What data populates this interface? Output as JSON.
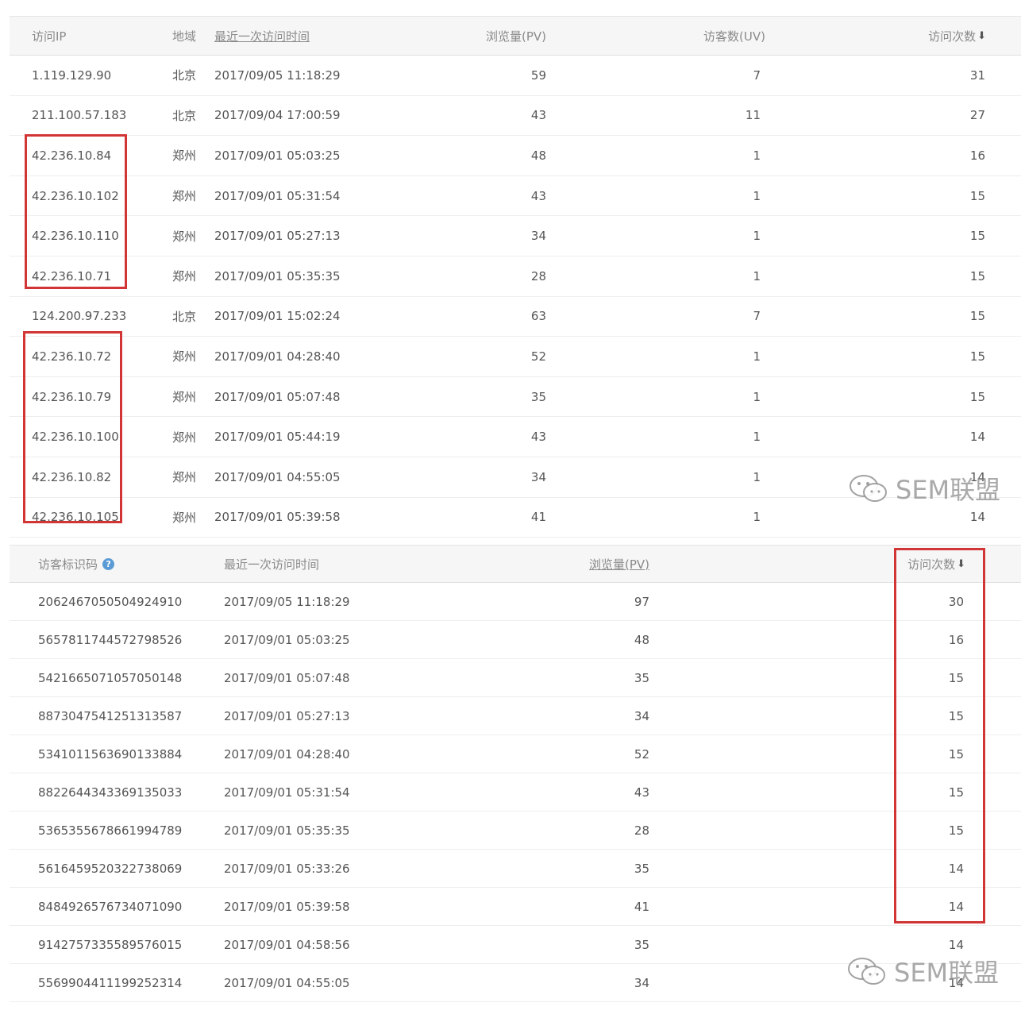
{
  "ip_table": {
    "headers": {
      "ip": "访问IP",
      "region": "地域",
      "last_visit": "最近一次访问时间",
      "pv": "浏览量(PV)",
      "uv": "访客数(UV)",
      "visits": "访问次数"
    },
    "rows": [
      [
        "1.119.129.90",
        "北京",
        "2017/09/05 11:18:29",
        "59",
        "7",
        "31"
      ],
      [
        "211.100.57.183",
        "北京",
        "2017/09/04 17:00:59",
        "43",
        "11",
        "27"
      ],
      [
        "42.236.10.84",
        "郑州",
        "2017/09/01 05:03:25",
        "48",
        "1",
        "16"
      ],
      [
        "42.236.10.102",
        "郑州",
        "2017/09/01 05:31:54",
        "43",
        "1",
        "15"
      ],
      [
        "42.236.10.110",
        "郑州",
        "2017/09/01 05:27:13",
        "34",
        "1",
        "15"
      ],
      [
        "42.236.10.71",
        "郑州",
        "2017/09/01 05:35:35",
        "28",
        "1",
        "15"
      ],
      [
        "124.200.97.233",
        "北京",
        "2017/09/01 15:02:24",
        "63",
        "7",
        "15"
      ],
      [
        "42.236.10.72",
        "郑州",
        "2017/09/01 04:28:40",
        "52",
        "1",
        "15"
      ],
      [
        "42.236.10.79",
        "郑州",
        "2017/09/01 05:07:48",
        "35",
        "1",
        "15"
      ],
      [
        "42.236.10.100",
        "郑州",
        "2017/09/01 05:44:19",
        "43",
        "1",
        "14"
      ],
      [
        "42.236.10.82",
        "郑州",
        "2017/09/01 04:55:05",
        "34",
        "1",
        "14"
      ],
      [
        "42.236.10.105",
        "郑州",
        "2017/09/01 05:39:58",
        "41",
        "1",
        "14"
      ]
    ]
  },
  "visitor_table": {
    "headers": {
      "visitor_id": "访客标识码",
      "last_visit": "最近一次访问时间",
      "pv": "浏览量(PV)",
      "visits": "访问次数"
    },
    "rows": [
      [
        "2062467050504924910",
        "2017/09/05 11:18:29",
        "97",
        "30"
      ],
      [
        "5657811744572798526",
        "2017/09/01 05:03:25",
        "48",
        "16"
      ],
      [
        "5421665071057050148",
        "2017/09/01 05:07:48",
        "35",
        "15"
      ],
      [
        "8873047541251313587",
        "2017/09/01 05:27:13",
        "34",
        "15"
      ],
      [
        "5341011563690133884",
        "2017/09/01 04:28:40",
        "52",
        "15"
      ],
      [
        "8822644343369135033",
        "2017/09/01 05:31:54",
        "43",
        "15"
      ],
      [
        "5365355678661994789",
        "2017/09/01 05:35:35",
        "28",
        "15"
      ],
      [
        "5616459520322738069",
        "2017/09/01 05:33:26",
        "35",
        "14"
      ],
      [
        "8484926576734071090",
        "2017/09/01 05:39:58",
        "41",
        "14"
      ],
      [
        "9142757335589576015",
        "2017/09/01 04:58:56",
        "35",
        "14"
      ],
      [
        "5569904411199252314",
        "2017/09/01 04:55:05",
        "34",
        "14"
      ]
    ]
  },
  "icons": {
    "sort": "sort-desc-icon",
    "help": "help-icon",
    "watermark": "wechat-icon"
  },
  "glyphs": {
    "sort_arrow": "⬇",
    "help": "?"
  },
  "watermark_text": "SEM联盟",
  "colors": {
    "highlight": "#d23535",
    "help_icon": "#5b9bd5",
    "header_bg": "#f6f6f6"
  }
}
